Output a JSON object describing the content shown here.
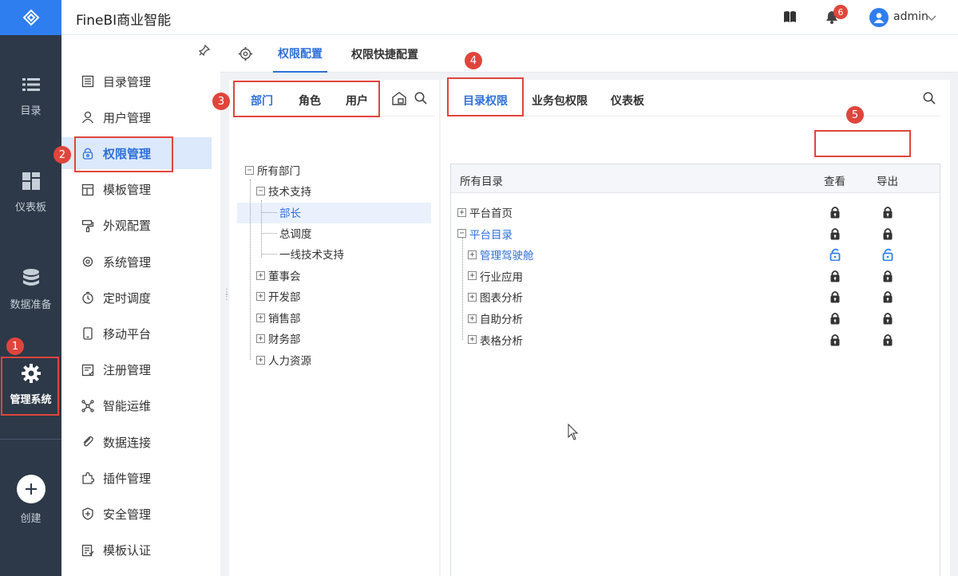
{
  "app": {
    "title": "FineBI商业智能"
  },
  "header": {
    "notification_count": "6",
    "user": "admin"
  },
  "rail": {
    "items": [
      {
        "label": "目录",
        "icon": "list-icon"
      },
      {
        "label": "仪表板",
        "icon": "dashboard-icon"
      },
      {
        "label": "数据准备",
        "icon": "database-icon"
      },
      {
        "label": "管理系统",
        "icon": "gear-icon"
      },
      {
        "label": "创建",
        "icon": "plus-icon"
      }
    ]
  },
  "submenu": {
    "items": [
      {
        "label": "目录管理"
      },
      {
        "label": "用户管理"
      },
      {
        "label": "权限管理"
      },
      {
        "label": "模板管理"
      },
      {
        "label": "外观配置"
      },
      {
        "label": "系统管理"
      },
      {
        "label": "定时调度"
      },
      {
        "label": "移动平台"
      },
      {
        "label": "注册管理"
      },
      {
        "label": "智能运维"
      },
      {
        "label": "数据连接"
      },
      {
        "label": "插件管理"
      },
      {
        "label": "安全管理"
      },
      {
        "label": "模板认证"
      }
    ]
  },
  "tabs": {
    "items": [
      {
        "label": "权限配置"
      },
      {
        "label": "权限快捷配置"
      }
    ]
  },
  "left": {
    "tabs": [
      {
        "label": "部门"
      },
      {
        "label": "角色"
      },
      {
        "label": "用户"
      }
    ],
    "tree": [
      {
        "label": "所有部门"
      },
      {
        "label": "技术支持"
      },
      {
        "label": "部长"
      },
      {
        "label": "总调度"
      },
      {
        "label": "一线技术支持"
      },
      {
        "label": "董事会"
      },
      {
        "label": "开发部"
      },
      {
        "label": "销售部"
      },
      {
        "label": "财务部"
      },
      {
        "label": "人力资源"
      }
    ]
  },
  "right": {
    "tabs": [
      {
        "label": "目录权限"
      },
      {
        "label": "业务包权限"
      },
      {
        "label": "仪表板"
      }
    ],
    "table": {
      "header": {
        "name": "所有目录",
        "view": "查看",
        "export": "导出"
      },
      "rows": [
        {
          "label": "平台首页",
          "view": "locked",
          "export": "locked"
        },
        {
          "label": "平台目录",
          "view": "locked",
          "export": "locked"
        },
        {
          "label": "管理驾驶舱",
          "view": "unlocked",
          "export": "unlocked"
        },
        {
          "label": "行业应用",
          "view": "locked",
          "export": "locked"
        },
        {
          "label": "图表分析",
          "view": "locked",
          "export": "locked"
        },
        {
          "label": "自助分析",
          "view": "locked",
          "export": "locked"
        },
        {
          "label": "表格分析",
          "view": "locked",
          "export": "locked"
        }
      ]
    }
  },
  "annotations": {
    "badges": [
      "1",
      "2",
      "3",
      "4",
      "5"
    ]
  },
  "colors": {
    "accent": "#2f6fd8",
    "rail": "#2d3948",
    "annotation": "#e0453c"
  }
}
